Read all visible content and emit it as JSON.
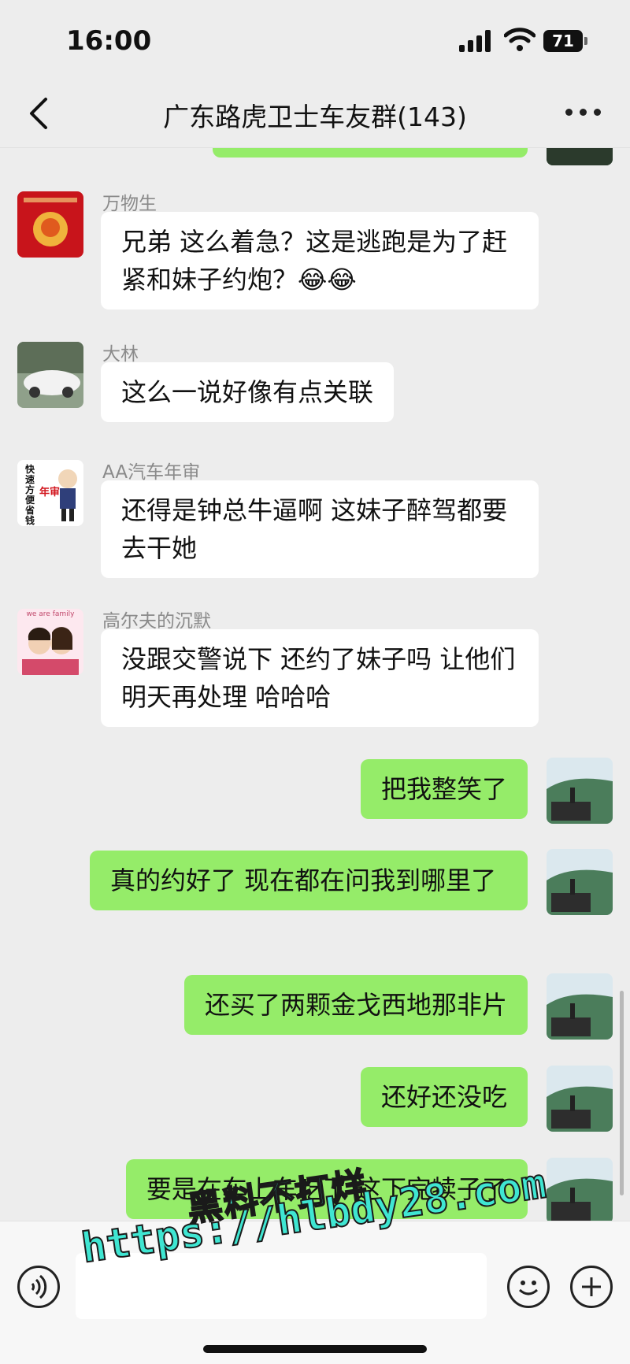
{
  "status_bar": {
    "time": "16:00",
    "battery": "71"
  },
  "header": {
    "title": "广东路虎卫士车友群(143)"
  },
  "messages": [
    {
      "sender": "万物生",
      "text": "兄弟 这么着急？这是逃跑是为了赶紧和妹子约炮？😂😂",
      "direction": "in"
    },
    {
      "sender": "大林",
      "text": "这么一说好像有点关联",
      "direction": "in"
    },
    {
      "sender": "AA汽车年审",
      "text": "还得是钟总牛逼啊 这妹子醉驾都要去干她",
      "direction": "in",
      "avatar_text": [
        "快",
        "速",
        "方",
        "便",
        "省",
        "钱"
      ],
      "avatar_badge": "年审"
    },
    {
      "sender": "高尔夫的沉默",
      "text": "没跟交警说下 还约了妹子吗 让他们明天再处理 哈哈哈",
      "direction": "in",
      "avatar_caption": "we are family"
    },
    {
      "text": "把我整笑了",
      "direction": "out"
    },
    {
      "text": "真的约好了 现在都在问我到哪里了",
      "direction": "out"
    },
    {
      "text": "还买了两颗金戈西地那非片",
      "direction": "out"
    },
    {
      "text": "还好还没吃",
      "direction": "out"
    },
    {
      "text": "要是在车上车吃了 这下完犊子了",
      "direction": "out"
    }
  ],
  "watermark": {
    "line1": "黑料不打烊",
    "line2": "https://hlbdy28.com"
  },
  "colors": {
    "background": "#ededed",
    "outgoing_bubble": "#95ec69",
    "incoming_bubble": "#ffffff",
    "watermark": "#3fe6d2"
  }
}
